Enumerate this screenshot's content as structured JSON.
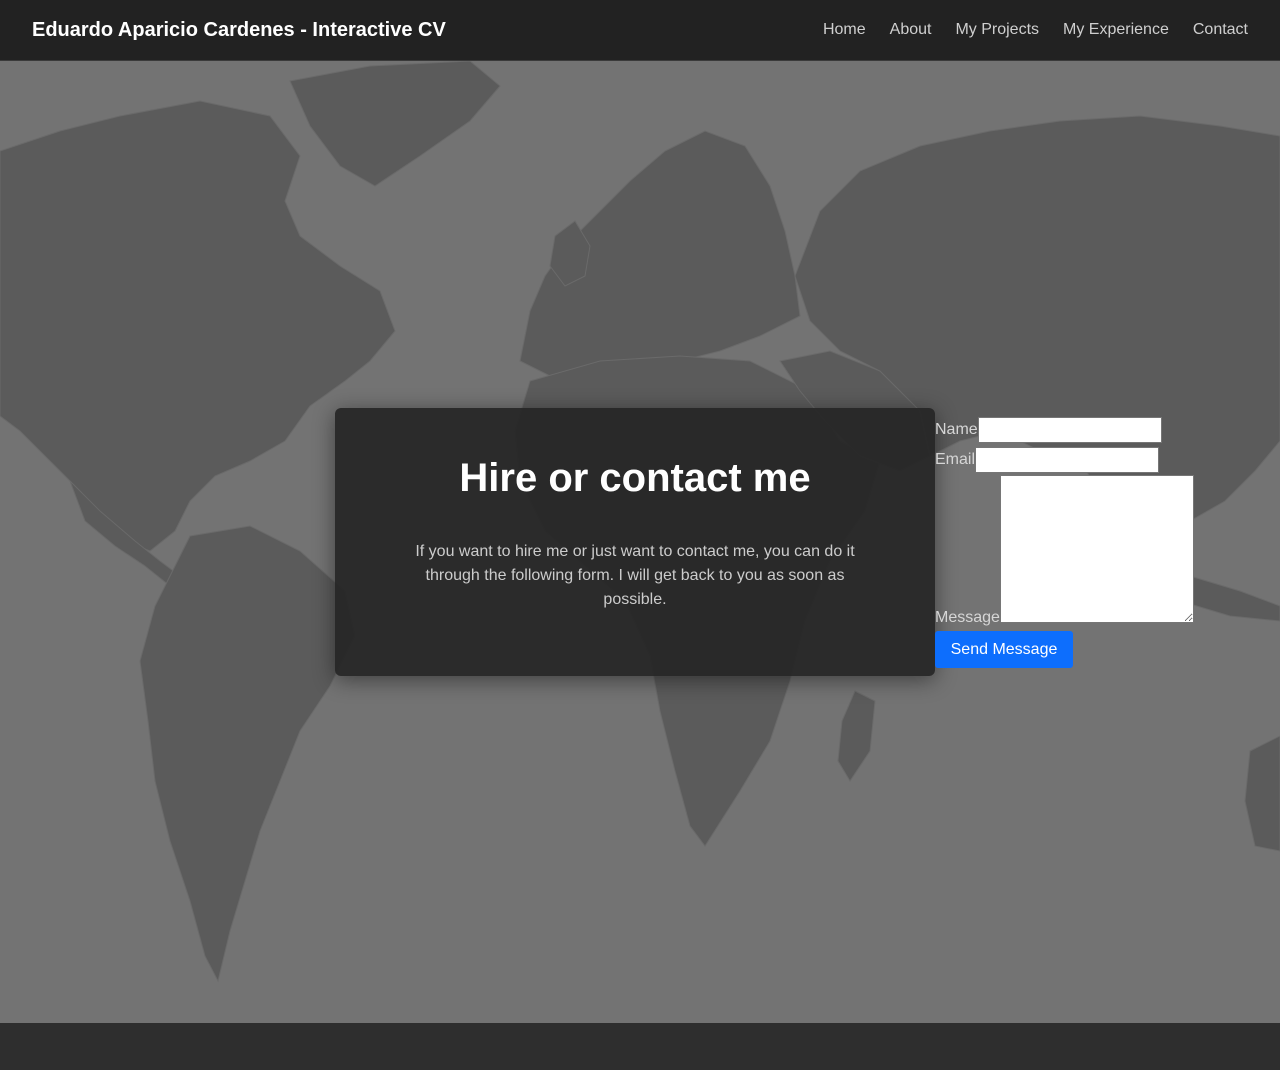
{
  "nav": {
    "brand": "Eduardo Aparicio Cardenes - Interactive CV",
    "links": [
      "Home",
      "About",
      "My Projects",
      "My Experience",
      "Contact"
    ]
  },
  "hero": {
    "title": "Hire or contact me",
    "description": "If you want to hire me or just want to contact me, you can do it through the following form. I will get back to you as soon as possible."
  },
  "form": {
    "name_label": "Name",
    "name_value": "",
    "email_label": "Email",
    "email_value": "",
    "message_label": "Message",
    "message_value": "",
    "submit_label": "Send Message"
  },
  "colors": {
    "navbar": "#222222",
    "hero_background": "#737373",
    "landmass": "#5b5b5b",
    "card": "#262626",
    "accent": "#0d6efd",
    "footer": "#2e2e2e"
  },
  "icons": [
    "world-map-background"
  ]
}
